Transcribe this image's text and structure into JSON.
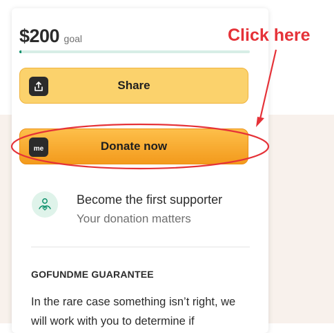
{
  "campaign": {
    "goal_amount": "$200",
    "goal_label": "goal",
    "progress_fraction": 0.008
  },
  "buttons": {
    "share_label": "Share",
    "share_icon": "share-upload-icon",
    "donate_label": "Donate now",
    "donate_icon": "gofundme-logo-icon",
    "donate_icon_text": "me"
  },
  "supporter": {
    "title": "Become the first supporter",
    "subtitle": "Your donation matters",
    "icon": "heart-hand-icon"
  },
  "guarantee": {
    "title": "GOFUNDME GUARANTEE",
    "body": "In the rare case something isn’t right, we will work with you to determine if"
  },
  "annotation": {
    "label": "Click here",
    "color": "#e53238"
  },
  "colors": {
    "accent_green": "#0a8f6a",
    "share_button": "#fbd26c",
    "donate_button": "#f6a42a"
  }
}
